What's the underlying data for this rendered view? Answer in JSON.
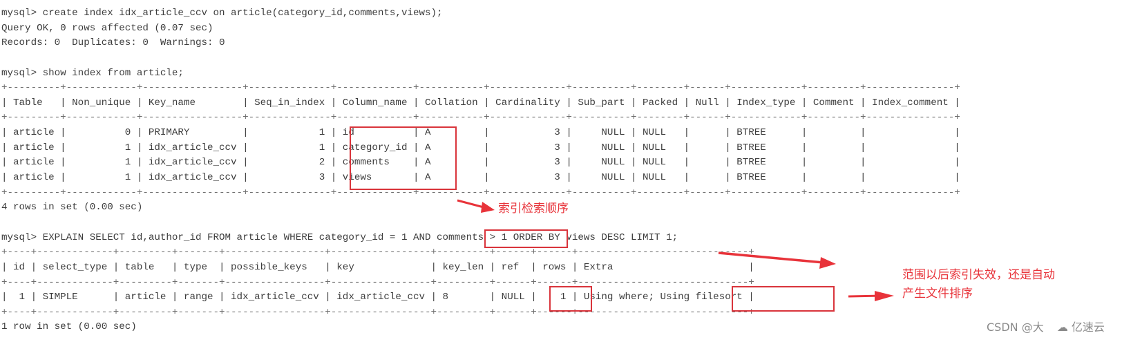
{
  "terminal": {
    "lines": [
      {
        "type": "text",
        "text": "mysql> create index idx_article_ccv on article(category_id,comments,views);"
      },
      {
        "type": "text",
        "text": "Query OK, 0 rows affected (0.07 sec)"
      },
      {
        "type": "text",
        "text": "Records: 0  Duplicates: 0  Warnings: 0"
      },
      {
        "type": "text",
        "text": ""
      },
      {
        "type": "text",
        "text": "mysql> show index from article;"
      },
      {
        "type": "border",
        "text": "+---------+------------+-----------------+--------------+-------------+-----------+-------------+----------+--------+------+------------+---------+---------------+"
      },
      {
        "type": "row",
        "text": "| Table   | Non_unique | Key_name        | Seq_in_index | Column_name | Collation | Cardinality | Sub_part | Packed | Null | Index_type | Comment | Index_comment |"
      },
      {
        "type": "border",
        "text": "+---------+------------+-----------------+--------------+-------------+-----------+-------------+----------+--------+------+------------+---------+---------------+"
      },
      {
        "type": "row",
        "text": "| article |          0 | PRIMARY         |            1 | id          | A         |           3 |     NULL | NULL   |      | BTREE      |         |               |"
      },
      {
        "type": "row",
        "text": "| article |          1 | idx_article_ccv |            1 | category_id | A         |           3 |     NULL | NULL   |      | BTREE      |         |               |"
      },
      {
        "type": "row",
        "text": "| article |          1 | idx_article_ccv |            2 | comments    | A         |           3 |     NULL | NULL   |      | BTREE      |         |               |"
      },
      {
        "type": "row",
        "text": "| article |          1 | idx_article_ccv |            3 | views       | A         |           3 |     NULL | NULL   |      | BTREE      |         |               |"
      },
      {
        "type": "border",
        "text": "+---------+------------+-----------------+--------------+-------------+-----------+-------------+----------+--------+------+------------+---------+---------------+"
      },
      {
        "type": "text",
        "text": "4 rows in set (0.00 sec)"
      },
      {
        "type": "text",
        "text": ""
      },
      {
        "type": "text",
        "text": "mysql> EXPLAIN SELECT id,author_id FROM article WHERE category_id = 1 AND comments > 1 ORDER BY views DESC LIMIT 1;"
      },
      {
        "type": "border",
        "text": "+----+-------------+---------+-------+-----------------+-----------------+---------+------+------+-----------------------------+"
      },
      {
        "type": "row",
        "text": "| id | select_type | table   | type  | possible_keys   | key             | key_len | ref  | rows | Extra                       |"
      },
      {
        "type": "border",
        "text": "+----+-------------+---------+-------+-----------------+-----------------+---------+------+------+-----------------------------+"
      },
      {
        "type": "row",
        "text": "|  1 | SIMPLE      | article | range | idx_article_ccv | idx_article_ccv | 8       | NULL |    1 | Using where; Using filesort |"
      },
      {
        "type": "border",
        "text": "+----+-------------+---------+-------+-----------------+-----------------+---------+------+------+-----------------------------+"
      },
      {
        "type": "text",
        "text": "1 row in set (0.00 sec)"
      }
    ]
  },
  "show_index_table": {
    "columns": [
      "Table",
      "Non_unique",
      "Key_name",
      "Seq_in_index",
      "Column_name",
      "Collation",
      "Cardinality",
      "Sub_part",
      "Packed",
      "Null",
      "Index_type",
      "Comment",
      "Index_comment"
    ],
    "rows": [
      [
        "article",
        "0",
        "PRIMARY",
        "1",
        "id",
        "A",
        "3",
        "NULL",
        "NULL",
        "",
        "BTREE",
        "",
        ""
      ],
      [
        "article",
        "1",
        "idx_article_ccv",
        "1",
        "category_id",
        "A",
        "3",
        "NULL",
        "NULL",
        "",
        "BTREE",
        "",
        ""
      ],
      [
        "article",
        "1",
        "idx_article_ccv",
        "2",
        "comments",
        "A",
        "3",
        "NULL",
        "NULL",
        "",
        "BTREE",
        "",
        ""
      ],
      [
        "article",
        "1",
        "idx_article_ccv",
        "3",
        "views",
        "A",
        "3",
        "NULL",
        "NULL",
        "",
        "BTREE",
        "",
        ""
      ]
    ]
  },
  "explain_table": {
    "columns": [
      "id",
      "select_type",
      "table",
      "type",
      "possible_keys",
      "key",
      "key_len",
      "ref",
      "rows",
      "Extra"
    ],
    "rows": [
      [
        "1",
        "SIMPLE",
        "article",
        "range",
        "idx_article_ccv",
        "idx_article_ccv",
        "8",
        "NULL",
        "1",
        "Using where; Using filesort"
      ]
    ]
  },
  "annotations": {
    "index_order_note": "索引检索顺序",
    "range_note_line1": "范围以后索引失效，还是自动",
    "range_note_line2": "产生文件排序",
    "accent_color": "#e8333a"
  },
  "watermark": {
    "csdn": "CSDN @大",
    "brand": "亿速云",
    "brand_icon": "cloud-logo-icon"
  }
}
